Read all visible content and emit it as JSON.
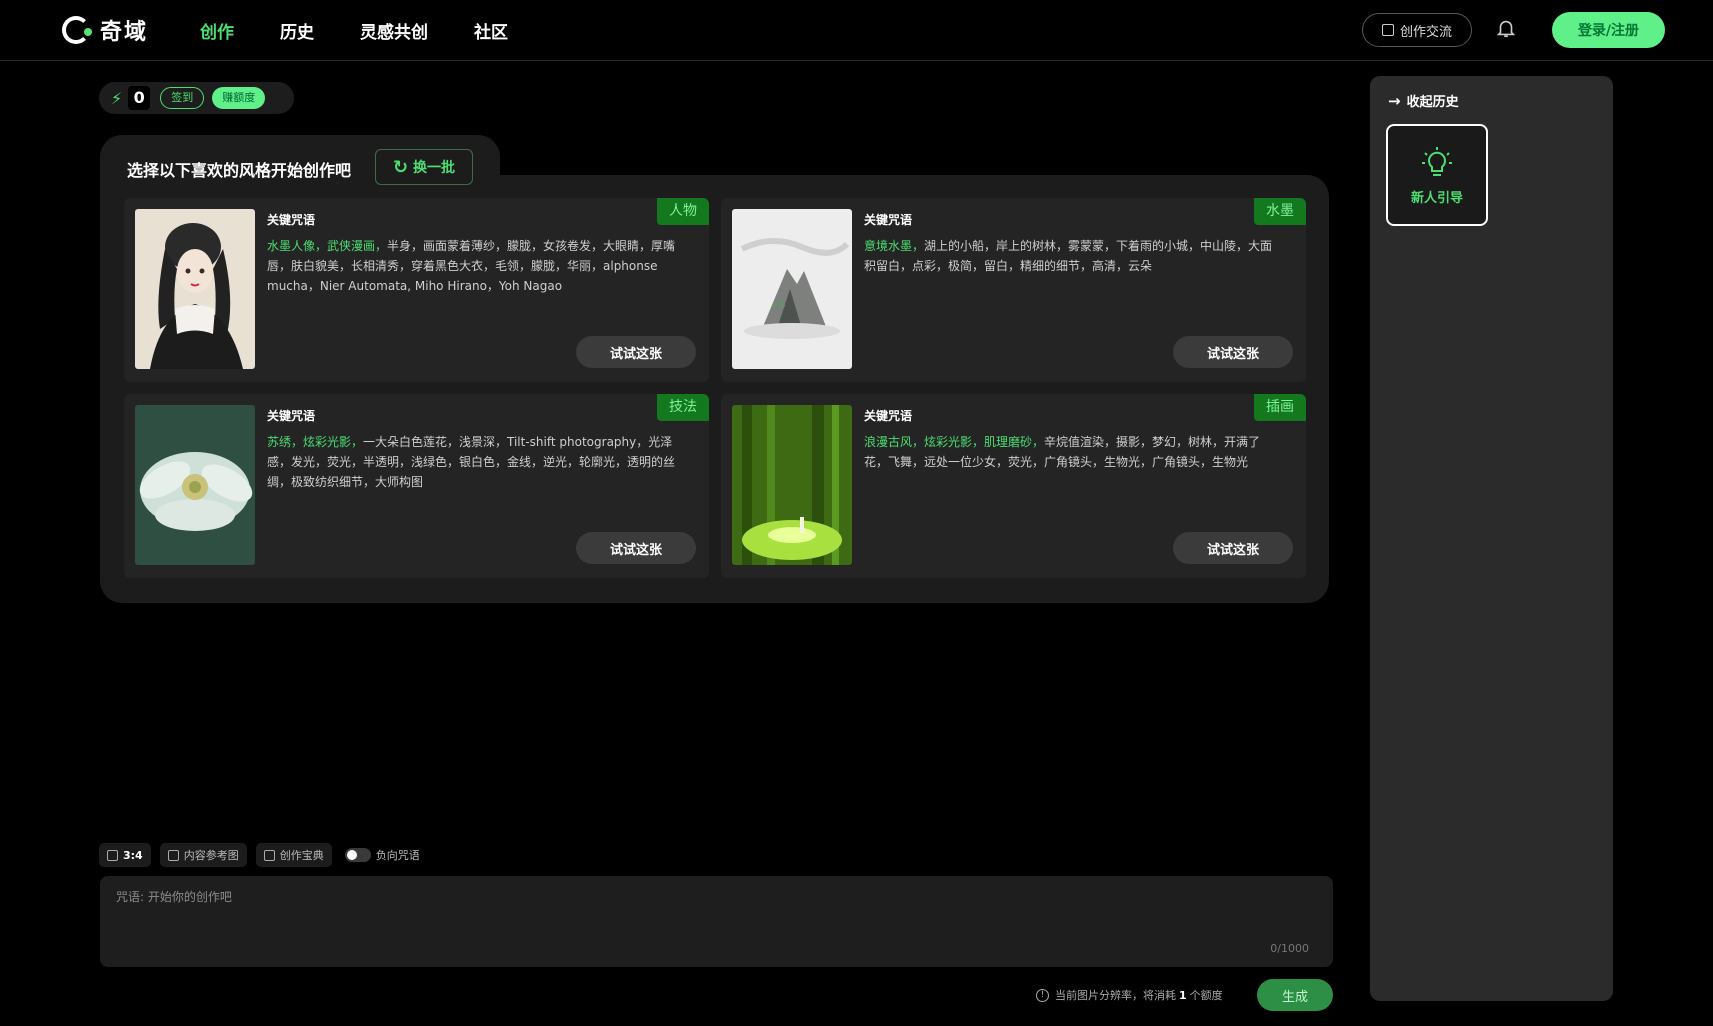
{
  "header": {
    "logo_text": "奇域",
    "nav": [
      "创作",
      "历史",
      "灵感共创",
      "社区"
    ],
    "exchange_label": "创作交流",
    "login_label": "登录/注册"
  },
  "credits": {
    "value": "0",
    "sign_in_label": "签到",
    "earn_label": "赚额度"
  },
  "panel": {
    "title": "选择以下喜欢的风格开始创作吧",
    "refresh_label": "换一批"
  },
  "cards": [
    {
      "tag": "人物",
      "label": "关键咒语",
      "highlight": "水墨人像，武侠漫画，",
      "text": "半身，画面蒙着薄纱，朦胧，女孩卷发，大眼睛，厚嘴唇，肤白貌美，长相清秀，穿着黑色大衣，毛领，朦胧，华丽，alphonse mucha，Nier Automata, Miho Hirano，Yoh Nagao",
      "button": "试试这张"
    },
    {
      "tag": "水墨",
      "label": "关键咒语",
      "highlight": "意境水墨，",
      "text": "湖上的小船，岸上的树林，雾蒙蒙，下着雨的小城，中山陵，大面积留白，点彩，极简，留白，精细的细节，高清，云朵",
      "button": "试试这张"
    },
    {
      "tag": "技法",
      "label": "关键咒语",
      "highlight": "苏绣，炫彩光影，",
      "text": "一大朵白色莲花，浅景深，Tilt-shift photography，光泽感，发光，荧光，半透明，浅绿色，银白色，金线，逆光，轮廓光，透明的丝绸，极致纺织细节，大师构图",
      "button": "试试这张"
    },
    {
      "tag": "插画",
      "label": "关键咒语",
      "highlight": "浪漫古风，炫彩光影，肌理磨砂，",
      "text": "辛烷值渲染，摄影，梦幻，树林，开满了花，飞舞，远处一位少女，荧光，广角镜头，生物光，广角镜头，生物光",
      "button": "试试这张"
    }
  ],
  "tools": {
    "ratio": "3:4",
    "reference": "内容参考图",
    "guide_book": "创作宝典",
    "negative": "负向咒语"
  },
  "prompt": {
    "placeholder": "咒语: 开始你的创作吧",
    "counter": "0/1000"
  },
  "cost": {
    "prefix": "当前图片分辨率，将消耗",
    "amount": "1",
    "suffix": "个额度"
  },
  "generate_label": "生成",
  "sidebar": {
    "collapse_label": "收起历史",
    "guide_label": "新人引导"
  },
  "colors": {
    "accent": "#4cde72",
    "tag_bg": "#13781e"
  }
}
